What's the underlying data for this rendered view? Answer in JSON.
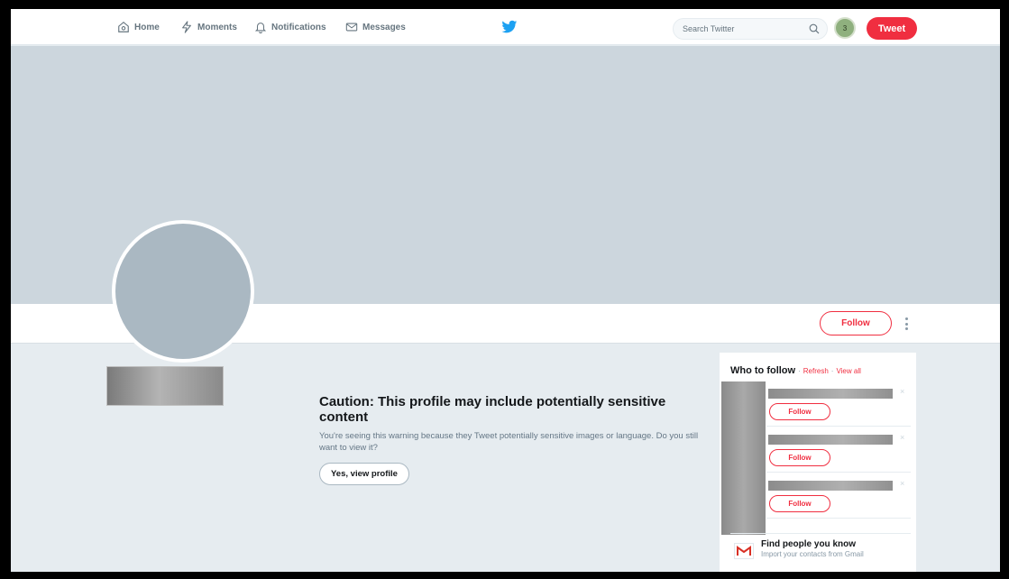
{
  "nav": {
    "home": "Home",
    "moments": "Moments",
    "notifications": "Notifications",
    "messages": "Messages",
    "search_placeholder": "Search Twitter",
    "avatar_badge": "3",
    "tweet": "Tweet"
  },
  "profile": {
    "follow": "Follow"
  },
  "caution": {
    "title": "Caution: This profile may include potentially sensitive content",
    "text": "You're seeing this warning because they Tweet potentially sensitive images or language. Do you still want to view it?",
    "button": "Yes, view profile"
  },
  "who_to_follow": {
    "title": "Who to follow",
    "separator": "·",
    "refresh": "Refresh",
    "view_all": "View all",
    "suggestions": [
      {
        "follow": "Follow",
        "close": "×"
      },
      {
        "follow": "Follow",
        "close": "×"
      },
      {
        "follow": "Follow",
        "close": "×"
      }
    ],
    "find_title": "Find people you know",
    "find_sub": "Import your contacts from Gmail"
  },
  "colors": {
    "accent": "#f02e40",
    "banner": "#ccd6dd",
    "page_bg": "#e6ecf0",
    "twitter_blue": "#1da1f2"
  },
  "icons": [
    "home-icon",
    "lightning-icon",
    "bell-icon",
    "envelope-icon",
    "twitter-bird-icon",
    "search-icon",
    "more-dots-icon",
    "gmail-icon"
  ]
}
